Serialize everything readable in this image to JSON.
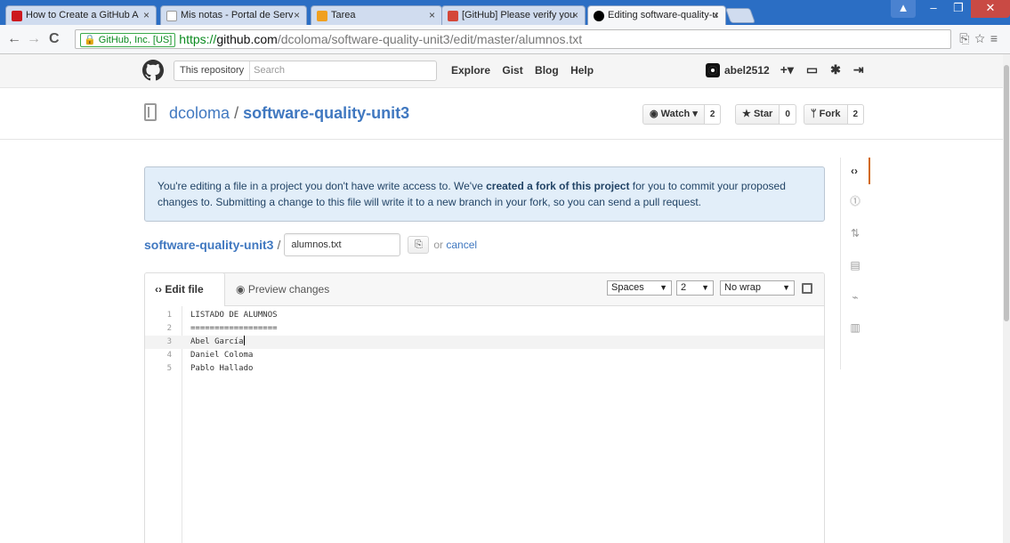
{
  "browser": {
    "tabs": [
      {
        "title": "How to Create a GitHub A",
        "favicon_color": "#cc181e",
        "active": false
      },
      {
        "title": "Mis notas - Portal de Serv",
        "favicon_color": "#ffffff",
        "active": false
      },
      {
        "title": "Tarea",
        "favicon_color": "#f0a020",
        "active": false
      },
      {
        "title": "[GitHub] Please verify you",
        "favicon_color": "#d44638",
        "active": false
      },
      {
        "title": "Editing software-quality-u",
        "favicon_color": "#000000",
        "active": true
      }
    ],
    "ev_label": "GitHub, Inc. [US]",
    "url_scheme": "https://",
    "url_host": "github.com",
    "url_path": "/dcoloma/software-quality-unit3/edit/master/alumnos.txt"
  },
  "header": {
    "search_scope": "This repository",
    "search_placeholder": "Search",
    "nav": [
      "Explore",
      "Gist",
      "Blog",
      "Help"
    ],
    "username": "abel2512"
  },
  "repo": {
    "owner": "dcoloma",
    "separator": "/",
    "name": "software-quality-unit3",
    "watch_label": "Watch",
    "watch_count": "2",
    "star_label": "Star",
    "star_count": "0",
    "fork_label": "Fork",
    "fork_count": "2"
  },
  "flash": {
    "text_before": "You're editing a file in a project you don't have write access to. We've ",
    "bold": "created a fork of this project",
    "text_after": " for you to commit your proposed changes to. Submitting a change to this file will write it to a new branch in your fork, so you can send a pull request."
  },
  "breadcrumb": {
    "repo": "software-quality-unit3",
    "separator": "/",
    "filename": "alumnos.txt",
    "or_text": "or",
    "cancel": "cancel"
  },
  "editor": {
    "tab_edit": "Edit file",
    "tab_preview": "Preview changes",
    "indent_mode": "Spaces",
    "indent_size": "2",
    "wrap_mode": "No wrap",
    "current_line": 3,
    "lines": [
      {
        "n": "1",
        "text": "LISTADO DE ALUMNOS"
      },
      {
        "n": "2",
        "text": "=================="
      },
      {
        "n": "3",
        "text": "Abel García"
      },
      {
        "n": "4",
        "text": "Daniel Coloma"
      },
      {
        "n": "5",
        "text": "Pablo Hallado"
      }
    ]
  },
  "colors": {
    "link": "#4078c0",
    "flash_bg": "#e2eef9",
    "sidenav_active": "#d26911"
  }
}
